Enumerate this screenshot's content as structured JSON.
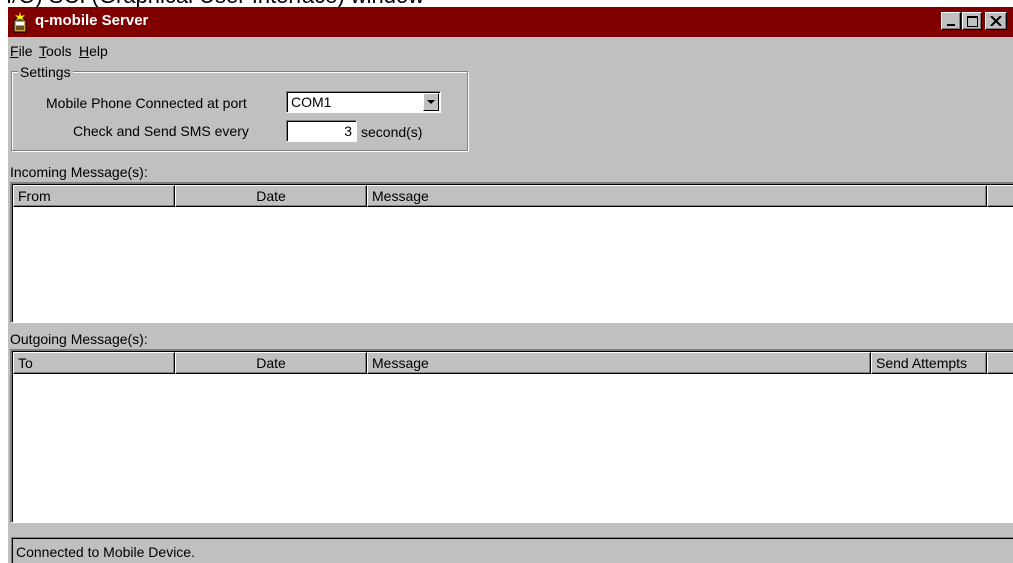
{
  "caption": {
    "text": "I/O) SCI (Graphical User Interface) window"
  },
  "window": {
    "title": "q-mobile Server",
    "controls": {
      "minimize_icon": "minimize-icon",
      "maximize_icon": "maximize-icon",
      "close_icon": "close-icon"
    },
    "title_bar_color": "#800000",
    "face_color": "#c0c0c0"
  },
  "menu": {
    "file": {
      "accel": "F",
      "rest": "ile"
    },
    "tools": {
      "accel": "T",
      "rest": "ools"
    },
    "help": {
      "accel": "H",
      "rest": "elp"
    }
  },
  "settings": {
    "group_title": "Settings",
    "port_label": "Mobile Phone Connected at port",
    "port_value": "COM1",
    "interval_label": "Check and Send SMS every",
    "interval_value": "3",
    "interval_unit": "second(s)"
  },
  "incoming": {
    "label": "Incoming Message(s):",
    "columns": [
      "From",
      "Date",
      "Message",
      ""
    ],
    "rows": []
  },
  "outgoing": {
    "label": "Outgoing Message(s):",
    "columns": [
      "To",
      "Date",
      "Message",
      "Send Attempts",
      ""
    ],
    "rows": []
  },
  "status": {
    "text": "Connected to Mobile Device."
  }
}
